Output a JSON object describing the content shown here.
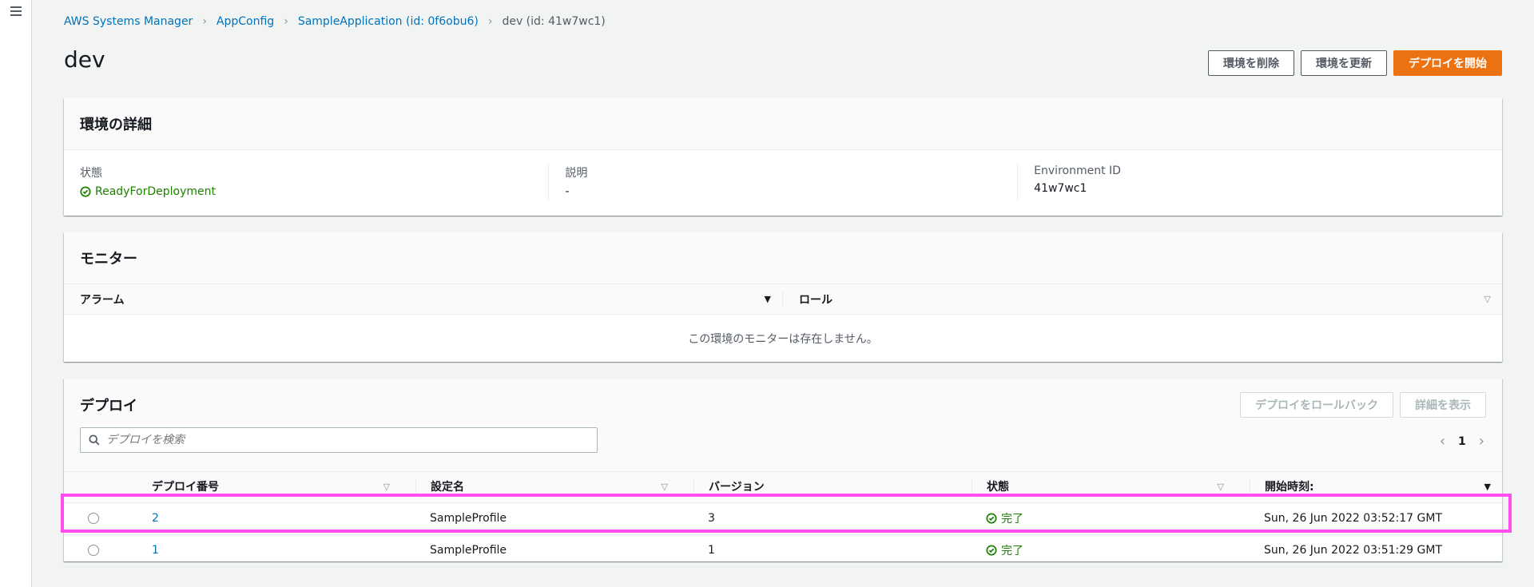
{
  "breadcrumb": {
    "items": [
      "AWS Systems Manager",
      "AppConfig",
      "SampleApplication (id: 0f6obu6)"
    ],
    "current": "dev (id: 41w7wc1)"
  },
  "page": {
    "title": "dev",
    "actions": {
      "delete": "環境を削除",
      "update": "環境を更新",
      "deploy": "デプロイを開始"
    }
  },
  "details": {
    "title": "環境の詳細",
    "status_label": "状態",
    "status_value": "ReadyForDeployment",
    "desc_label": "説明",
    "desc_value": "-",
    "envid_label": "Environment ID",
    "envid_value": "41w7wc1"
  },
  "monitor": {
    "title": "モニター",
    "col_alarm": "アラーム",
    "col_role": "ロール",
    "empty": "この環境のモニターは存在しません。"
  },
  "deployments": {
    "title": "デプロイ",
    "rollback": "デプロイをロールバック",
    "view_details": "詳細を表示",
    "search_placeholder": "デプロイを検索",
    "page": "1",
    "columns": [
      "デプロイ番号",
      "設定名",
      "バージョン",
      "状態",
      "開始時刻:"
    ],
    "rows": [
      {
        "number": "2",
        "config": "SampleProfile",
        "version": "3",
        "status": "完了",
        "started": "Sun, 26 Jun 2022 03:52:17 GMT"
      },
      {
        "number": "1",
        "config": "SampleProfile",
        "version": "1",
        "status": "完了",
        "started": "Sun, 26 Jun 2022 03:51:29 GMT"
      }
    ]
  },
  "colors": {
    "link": "#0073bb",
    "primary": "#ec7211",
    "success": "#1d8102",
    "highlight": "#ff4df0"
  }
}
